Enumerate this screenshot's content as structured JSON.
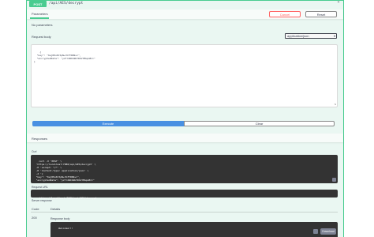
{
  "operation": {
    "method": "POST",
    "path": "/api/AES/decrypt"
  },
  "parameters": {
    "tab_label": "Parameters",
    "cancel_label": "Cancel",
    "reset_label": "Reset",
    "none_text": "No parameters"
  },
  "request_body": {
    "label": "Request body",
    "content_type": "application/json",
    "value": "{\n  \"key\": \"6ejN5oKCtpN+7mfYDN9+=\",\n  \"encryptedData\": \"yzTrdWIb9kYDOxYMGpnB==\"\n}"
  },
  "actions": {
    "execute_label": "Execute",
    "clear_label": "Clear"
  },
  "responses": {
    "header": "Responses",
    "curl_label": "Curl",
    "curl_value": "curl -X 'POST' \\\n  'https://localhost:7080/api/AES/decrypt' \\\n  -H 'accept: */*' \\\n  -H 'Content-Type: application/json' \\\n  -d '{\n  \"key\": \"6ejN5oKCtpN+7mfYDN9+=\",\n  \"encryptedData\": \"yzTrdWIb9kYDOxYMGpnB==\"",
    "request_url_label": "Request URL",
    "request_url": "https://localhost:7080/api/AES/decrypt",
    "server_response_label": "Server response",
    "col_code": "Code",
    "col_details": "Details",
    "status_code": "200",
    "response_body_label": "Response body",
    "response_body": "Welcome!!!",
    "download_label": "Download"
  }
}
